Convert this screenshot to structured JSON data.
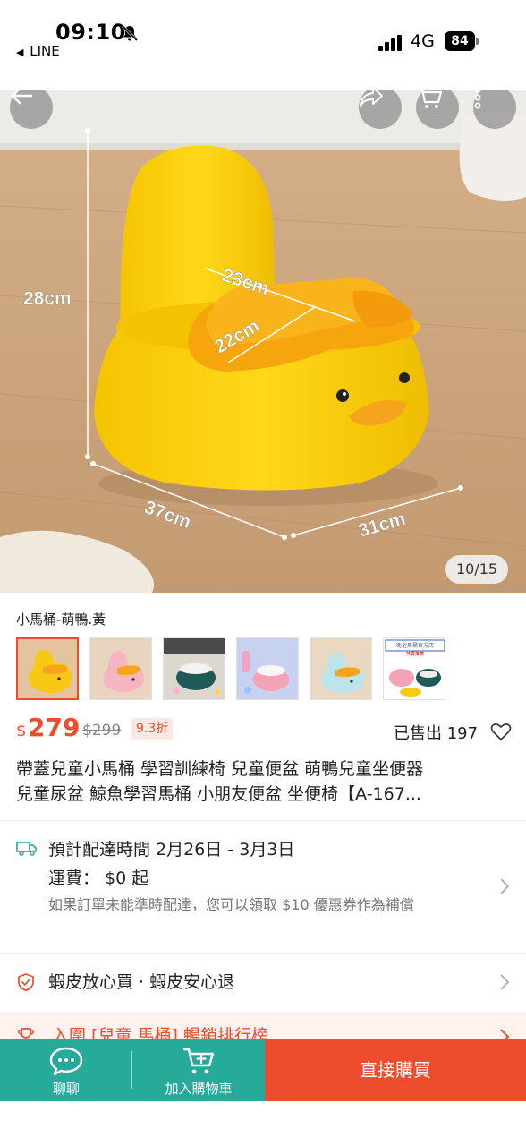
{
  "status_bar": {
    "time": "09:10",
    "back_app": "LINE",
    "network": "4G",
    "battery": "84"
  },
  "hero": {
    "image_counter": "10/15",
    "dimension_labels": [
      "28cm",
      "23cm",
      "22cm",
      "37cm",
      "31cm"
    ],
    "buttons": [
      "back-arrow-icon",
      "share-icon",
      "cart-icon",
      "more-icon"
    ]
  },
  "variant": {
    "title": "小馬桶-萌鴨.黃",
    "badge_lines": [
      "衛浴馬桶官方店",
      "熱賣推薦"
    ],
    "selected_index": 0
  },
  "price": {
    "currency": "$",
    "current": "279",
    "original": "$299",
    "discount": "9.3折",
    "sold": "已售出 197"
  },
  "product_title": {
    "line1": "帶蓋兒童小馬桶 學習訓練椅 兒童便盆 萌鴨兒童坐便器",
    "line2": "兒童尿盆 鯨魚學習馬桶 小朋友便盆 坐便椅【A-167..."
  },
  "delivery": {
    "label": "預計配達時間 2月26日 - 3月3日",
    "shipping": "運費： $0 起",
    "note": "如果訂單未能準時配達，您可以領取 $10 優惠券作為補償"
  },
  "guarantee": {
    "text": "蝦皮放心買 · 蝦皮安心退"
  },
  "ranking": {
    "text": "入圍 [兒童 馬桶] 暢銷排行榜"
  },
  "bottom_bar": {
    "chat": "聊聊",
    "add_to_cart": "加入購物車",
    "buy_now": "直接購買"
  },
  "colors": {
    "brand": "#ee4d2d",
    "teal": "#26aa99",
    "potty_yellow": "#f7c914",
    "duck_orange": "#f6a41c"
  }
}
